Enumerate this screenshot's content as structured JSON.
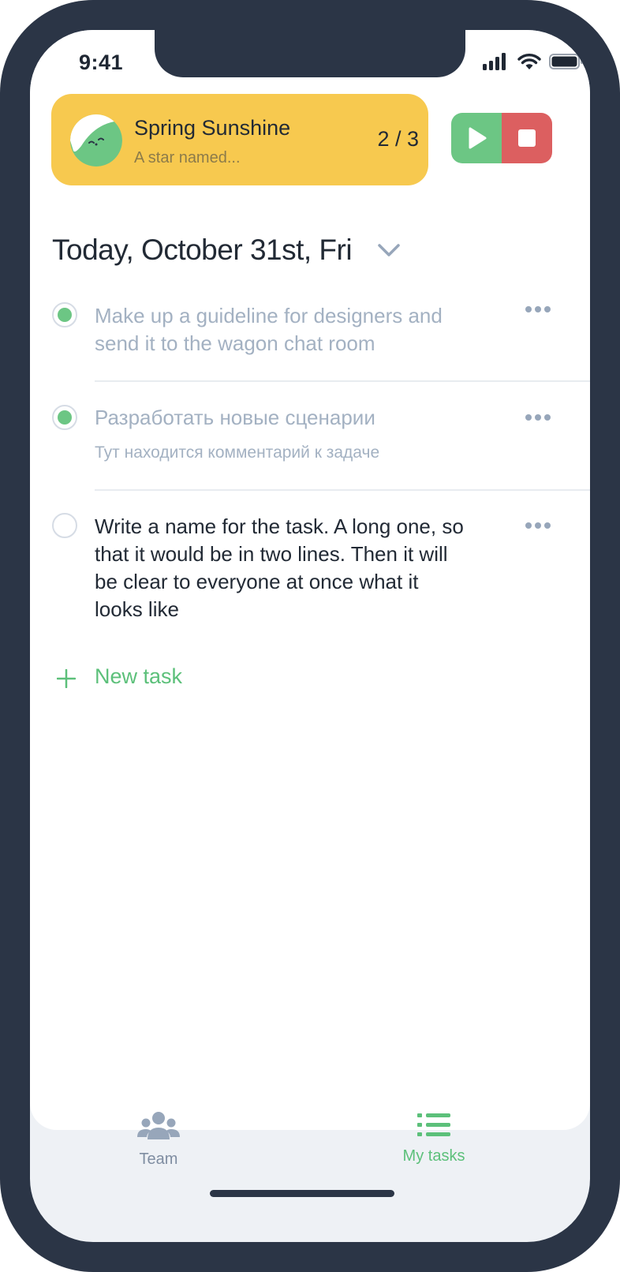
{
  "status_bar": {
    "time": "9:41",
    "icons": [
      "cellular-signal-icon",
      "wifi-icon",
      "battery-icon"
    ]
  },
  "player": {
    "title": "Spring Sunshine",
    "subtitle": "A star named...",
    "counter": "2 / 3",
    "play_icon": "play-icon",
    "stop_icon": "stop-icon"
  },
  "header": {
    "date_title": "Today, October 31st, Fri",
    "chevron_icon": "chevron-down-icon"
  },
  "tasks": [
    {
      "title": "Make up a guideline for designers and send it to the wagon chat room",
      "comment": "",
      "done": true
    },
    {
      "title": "Разработать новые сценарии",
      "comment": "Тут находится комментарий к задаче",
      "done": true
    },
    {
      "title": "Write a name for the task. A long one, so that it would be in two lines. Then it will be clear to everyone at once what it looks like",
      "comment": "",
      "done": false
    }
  ],
  "new_task": {
    "label": "New task",
    "icon": "plus-icon"
  },
  "tab_bar": {
    "tabs": [
      {
        "label": "Team",
        "icon": "team-icon",
        "active": false
      },
      {
        "label": "My tasks",
        "icon": "list-icon",
        "active": true
      }
    ]
  },
  "colors": {
    "frame": "#2b3546",
    "accent_green": "#5cc07a",
    "player_yellow": "#f7c94f",
    "stop_red": "#dc5f60",
    "muted_text": "#a3b1c2",
    "primary_text": "#222a35"
  }
}
